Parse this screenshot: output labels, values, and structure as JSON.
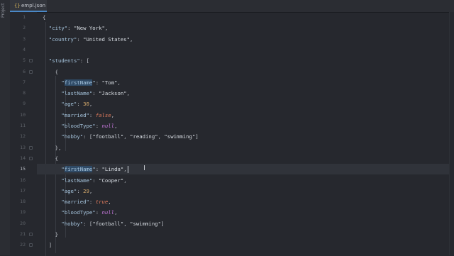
{
  "sidebar": {
    "vertical_label": "Project"
  },
  "tab": {
    "label": "empl.json",
    "icon": "json-file-icon"
  },
  "editor": {
    "active_line": 15,
    "lines": [
      {
        "n": "1"
      },
      {
        "n": "2"
      },
      {
        "n": "3"
      },
      {
        "n": "4"
      },
      {
        "n": "5"
      },
      {
        "n": "6"
      },
      {
        "n": "7"
      },
      {
        "n": "8"
      },
      {
        "n": "9"
      },
      {
        "n": "10"
      },
      {
        "n": "11"
      },
      {
        "n": "12"
      },
      {
        "n": "13"
      },
      {
        "n": "14"
      },
      {
        "n": "15"
      },
      {
        "n": "16"
      },
      {
        "n": "17"
      },
      {
        "n": "18"
      },
      {
        "n": "19"
      },
      {
        "n": "20"
      },
      {
        "n": "21"
      },
      {
        "n": "22"
      }
    ],
    "code": {
      "l1_open": "{",
      "l2_key": "\"city\"",
      "l2_sep": ": ",
      "l2_val": "\"New York\"",
      "l2_end": ",",
      "l3_key": "\"country\"",
      "l3_sep": ": ",
      "l3_val": "\"United States\"",
      "l3_end": ",",
      "l5_key": "\"students\"",
      "l5_sep": ": ",
      "l5_val": "[",
      "l6": "{",
      "l7_q": "\"",
      "l7_keyname": "firstName",
      "l7_q2": "\"",
      "l7_sep": ": ",
      "l7_val": "\"Tom\"",
      "l7_end": ",",
      "l8_key": "\"lastName\"",
      "l8_sep": ": ",
      "l8_val": "\"Jackson\"",
      "l8_end": ",",
      "l9_key": "\"age\"",
      "l9_sep": ": ",
      "l9_val": "30",
      "l9_end": ",",
      "l10_key": "\"married\"",
      "l10_sep": ": ",
      "l10_val": "false",
      "l10_end": ",",
      "l11_key": "\"bloodType\"",
      "l11_sep": ": ",
      "l11_val": "null",
      "l11_end": ",",
      "l12_key": "\"hobby\"",
      "l12_sep": ": ",
      "l12_open": "[",
      "l12_v1": "\"football\"",
      "l12_c1": ", ",
      "l12_v2": "\"reading\"",
      "l12_c2": ", ",
      "l12_v3": "\"swimming\"",
      "l12_close": "]",
      "l13": "},",
      "l14": "{",
      "l15_q": "\"",
      "l15_keyname": "firstName",
      "l15_q2": "\"",
      "l15_sep": ": ",
      "l15_val": "\"Linda\"",
      "l15_end": ",",
      "l16_key": "\"lastName\"",
      "l16_sep": ": ",
      "l16_val": "\"Cooper\"",
      "l16_end": ",",
      "l17_key": "\"age\"",
      "l17_sep": ": ",
      "l17_val": "29",
      "l17_end": ",",
      "l18_key": "\"married\"",
      "l18_sep": ": ",
      "l18_val": "true",
      "l18_end": ",",
      "l19_key": "\"bloodType\"",
      "l19_sep": ": ",
      "l19_val": "null",
      "l19_end": ",",
      "l20_key": "\"hobby\"",
      "l20_sep": ": ",
      "l20_open": "[",
      "l20_v1": "\"football\"",
      "l20_c1": ", ",
      "l20_v2": "\"swimming\"",
      "l20_close": "]",
      "l21": "}",
      "l22": "]"
    }
  },
  "colors": {
    "background": "#26282e",
    "key": "#a8c7e0",
    "string": "#d8dde3",
    "number": "#d3a86b",
    "boolean": "#e07b5c",
    "null": "#c678dd"
  }
}
